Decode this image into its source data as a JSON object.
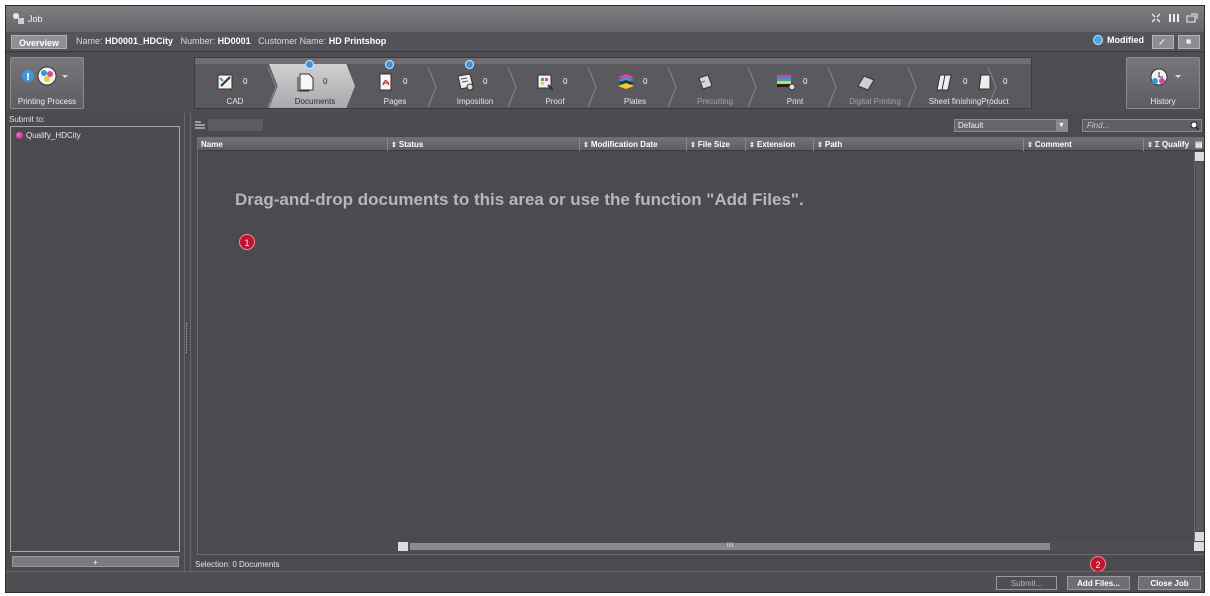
{
  "window": {
    "title": "Job"
  },
  "infobar": {
    "overview_tab": "Overview",
    "name_label": "Name:",
    "name_value": "HD0001_HDCity",
    "number_label": "Number:",
    "number_value": "HD0001",
    "customer_label": "Customer Name:",
    "customer_value": "HD Printshop",
    "status": "Modified",
    "status_color": "#3fa6e8"
  },
  "workflow": {
    "left_button": "Printing Process",
    "right_button": "History",
    "steps": [
      {
        "label": "CAD",
        "count": "0",
        "icon": "cad-icon"
      },
      {
        "label": "Documents",
        "count": "0",
        "icon": "documents-icon"
      },
      {
        "label": "Pages",
        "count": "0",
        "icon": "pages-icon"
      },
      {
        "label": "Imposition",
        "count": "0",
        "icon": "imposition-icon"
      },
      {
        "label": "Proof",
        "count": "0",
        "icon": "proof-icon"
      },
      {
        "label": "Plates",
        "count": "0",
        "icon": "plates-icon"
      },
      {
        "label": "Precutting",
        "count": "",
        "icon": "precutting-icon"
      },
      {
        "label": "Print",
        "count": "0",
        "icon": "print-icon"
      },
      {
        "label": "Digital Printing",
        "count": "",
        "icon": "digital-printing-icon"
      },
      {
        "label": "Sheet finishing",
        "count": "0",
        "icon": "sheet-finishing-icon"
      },
      {
        "label": "Product",
        "count": "0",
        "icon": "product-icon"
      }
    ]
  },
  "left_panel": {
    "submit_to_label": "Submit to:",
    "items": [
      {
        "label": "Qualify_HDCity"
      }
    ],
    "add_button": "+"
  },
  "main": {
    "view_select": "Default",
    "find_placeholder": "Find...",
    "columns": [
      "Name",
      "Status",
      "Modification Date",
      "File Size",
      "Extension",
      "Path",
      "Comment",
      "Σ Qualify"
    ],
    "empty_message": "Drag-and-drop documents to this area or use the function \"Add Files\".",
    "hscroll_grip": "IIII",
    "selection_info": "Selection:  0 Documents"
  },
  "annotations": {
    "badge1": "1",
    "badge2": "2"
  },
  "bottom": {
    "submit_button": "Submit...",
    "add_files_button": "Add Files...",
    "close_job_button": "Close Job"
  }
}
